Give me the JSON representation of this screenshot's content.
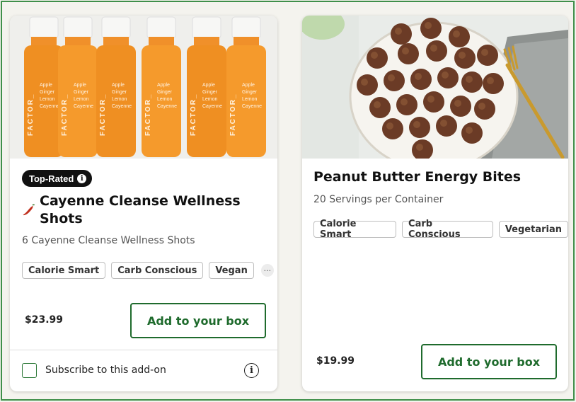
{
  "colors": {
    "accent_green": "#1f6b2d",
    "frame_green": "#3f8f4a",
    "badge_bg": "#111111",
    "chili_red": "#c0301e"
  },
  "cards": [
    {
      "badge": "Top-Rated",
      "badge_icon": "info-icon",
      "title_icon": "chili-pepper-icon",
      "title": "Cayenne Cleanse Wellness Shots",
      "subtitle": "6 Cayenne Cleanse Wellness Shots",
      "tags": [
        "Calorie Smart",
        "Carb Conscious",
        "Vegan"
      ],
      "more_tags": "···",
      "price": "$23.99",
      "button": "Add to your box",
      "subscribe_label": "Subscribe to this add-on",
      "subscribe_checked": false,
      "image_alt_text": [
        "FACTOR_",
        "Apple",
        "Ginger",
        "Lemon",
        "Cayenne"
      ]
    },
    {
      "title": "Peanut Butter Energy Bites",
      "subtitle": "20 Servings per Container",
      "tags": [
        "Calorie Smart",
        "Carb Conscious",
        "Vegetarian"
      ],
      "price": "$19.99",
      "button": "Add to your box"
    }
  ]
}
